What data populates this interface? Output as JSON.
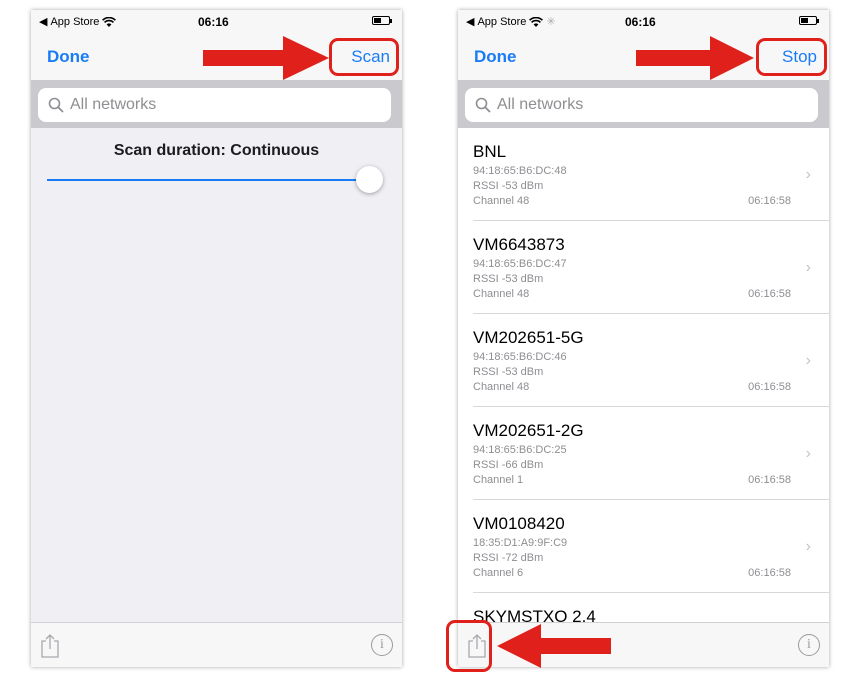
{
  "left_screen": {
    "status": {
      "back_label": "App Store",
      "time": "06:16"
    },
    "nav": {
      "done": "Done",
      "action": "Scan"
    },
    "search": {
      "placeholder": "All networks"
    },
    "scan_duration_label": "Scan duration: Continuous",
    "slider_value": 1.0
  },
  "right_screen": {
    "status": {
      "back_label": "App Store",
      "time": "06:16"
    },
    "nav": {
      "done": "Done",
      "action": "Stop"
    },
    "search": {
      "placeholder": "All networks"
    },
    "networks": [
      {
        "ssid": "BNL",
        "mac": "94:18:65:B6:DC:48",
        "rssi": "RSSI -53 dBm",
        "channel": "Channel 48",
        "time": "06:16:58"
      },
      {
        "ssid": "VM6643873",
        "mac": "94:18:65:B6:DC:47",
        "rssi": "RSSI -53 dBm",
        "channel": "Channel 48",
        "time": "06:16:58"
      },
      {
        "ssid": "VM202651-5G",
        "mac": "94:18:65:B6:DC:46",
        "rssi": "RSSI -53 dBm",
        "channel": "Channel 48",
        "time": "06:16:58"
      },
      {
        "ssid": "VM202651-2G",
        "mac": "94:18:65:B6:DC:25",
        "rssi": "RSSI -66 dBm",
        "channel": "Channel 1",
        "time": "06:16:58"
      },
      {
        "ssid": "VM0108420",
        "mac": "18:35:D1:A9:9F:C9",
        "rssi": "RSSI -72 dBm",
        "channel": "Channel 6",
        "time": "06:16:58"
      },
      {
        "ssid": "SKYMSTXO 2.4",
        "mac": "",
        "rssi": "",
        "channel": "",
        "time": ""
      }
    ]
  },
  "colors": {
    "accent": "#1a7cf5",
    "annotation": "#e0201b"
  },
  "icons": {
    "chevron": "›",
    "info": "i"
  }
}
